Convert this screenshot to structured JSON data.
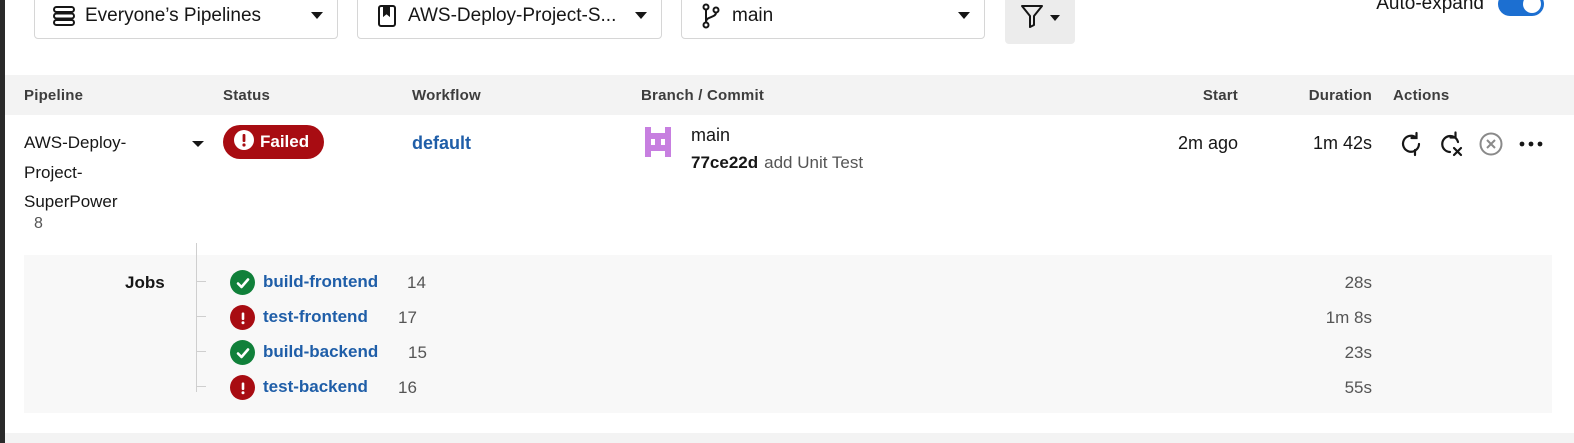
{
  "filters": {
    "pipelines_label": "Everyone’s Pipelines",
    "project_label": "AWS-Deploy-Project-S...",
    "branch_label": "main",
    "autoexpand_label": "Auto-expand",
    "autoexpand_on": true
  },
  "table": {
    "headers": {
      "pipeline": "Pipeline",
      "status": "Status",
      "workflow": "Workflow",
      "branch_commit": "Branch / Commit",
      "start": "Start",
      "duration": "Duration",
      "actions": "Actions"
    },
    "row": {
      "pipeline_name": "AWS-Deploy-Project-SuperPower",
      "pipeline_number": "8",
      "status": "Failed",
      "workflow": "default",
      "branch": "main",
      "commit_hash": "77ce22d",
      "commit_message": "add Unit Test",
      "start": "2m ago",
      "duration": "1m 42s"
    }
  },
  "jobs": {
    "label": "Jobs",
    "items": [
      {
        "name": "build-frontend",
        "number": "14",
        "status": "success",
        "duration": "28s"
      },
      {
        "name": "test-frontend",
        "number": "17",
        "status": "failed",
        "duration": "1m 8s"
      },
      {
        "name": "build-backend",
        "number": "15",
        "status": "success",
        "duration": "23s"
      },
      {
        "name": "test-backend",
        "number": "16",
        "status": "failed",
        "duration": "55s"
      }
    ]
  },
  "colors": {
    "failed": "#a80c12",
    "success": "#10803a",
    "link": "#1f5ea8",
    "toggle": "#1c6fd1",
    "avatar": "#c77fe0"
  },
  "icons": {
    "pipelines_dropdown": "pipelines-icon",
    "project_dropdown": "bookmark-icon",
    "branch_dropdown": "git-branch-icon",
    "filter": "filter-icon",
    "actions": [
      "rerun-icon",
      "rerun-failed-icon",
      "cancel-icon",
      "more-icon"
    ]
  }
}
